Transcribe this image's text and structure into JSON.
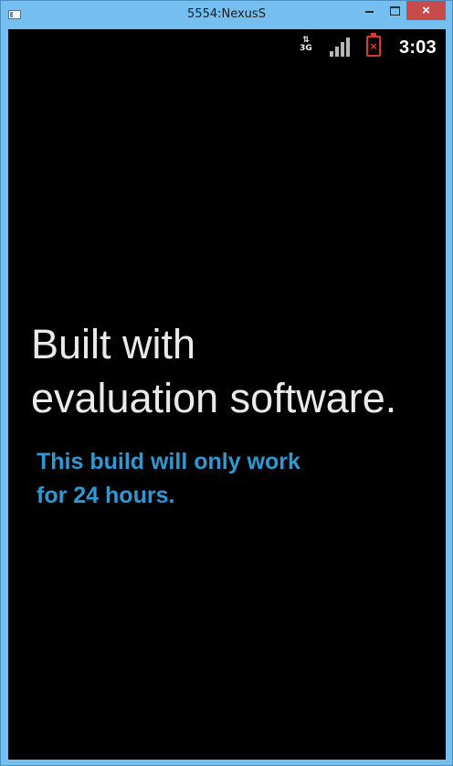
{
  "window": {
    "title": "5554:NexusS",
    "buttons": {
      "minimize_icon": "minimize-icon",
      "maximize_icon": "maximize-icon",
      "close_label": "×"
    }
  },
  "statusbar": {
    "network_arrows": "⇅",
    "network_type": "3G",
    "signal_bars": 4,
    "battery_status": "×",
    "time": "3:03"
  },
  "content": {
    "title": "Built with\nevaluation software.",
    "subtitle": "This build will only work\nfor 24 hours."
  },
  "colors": {
    "window_frame": "#74bfef",
    "close_button": "#c74c49",
    "screen_background": "#000000",
    "title_text": "#eaeaea",
    "subtitle_text": "#2c9ad5",
    "battery_warning": "#d73a2b"
  }
}
